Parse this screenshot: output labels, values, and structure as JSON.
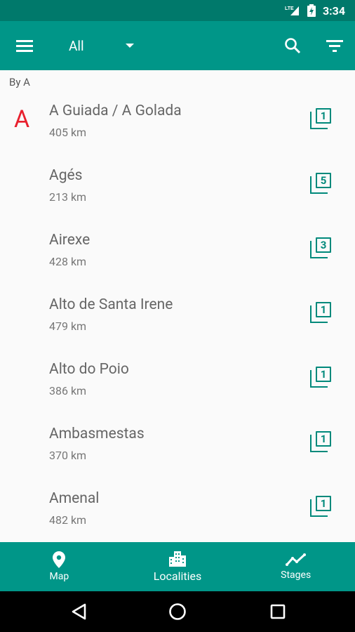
{
  "status_bar": {
    "network": "LTE",
    "time": "3:34"
  },
  "app_bar": {
    "filter_value": "All"
  },
  "section_header": "By A",
  "items": [
    {
      "letter": "A",
      "title": "A Guiada / A Golada",
      "distance": "405 km",
      "stages": "1"
    },
    {
      "letter": "",
      "title": "Agés",
      "distance": "213 km",
      "stages": "5"
    },
    {
      "letter": "",
      "title": "Airexe",
      "distance": "428 km",
      "stages": "3"
    },
    {
      "letter": "",
      "title": "Alto de Santa Irene",
      "distance": "479 km",
      "stages": "1"
    },
    {
      "letter": "",
      "title": "Alto do Poio",
      "distance": "386 km",
      "stages": "1"
    },
    {
      "letter": "",
      "title": "Ambasmestas",
      "distance": "370 km",
      "stages": "1"
    },
    {
      "letter": "",
      "title": "Amenal",
      "distance": "482 km",
      "stages": "1"
    }
  ],
  "bottom_nav": [
    {
      "label": "Map",
      "icon": "map-pin-icon"
    },
    {
      "label": "Localities",
      "icon": "buildings-icon",
      "active": true
    },
    {
      "label": "Stages",
      "icon": "trend-icon"
    }
  ],
  "colors": {
    "primary": "#009688",
    "primary_dark": "#00796b",
    "accent_letter": "#e8202e"
  }
}
